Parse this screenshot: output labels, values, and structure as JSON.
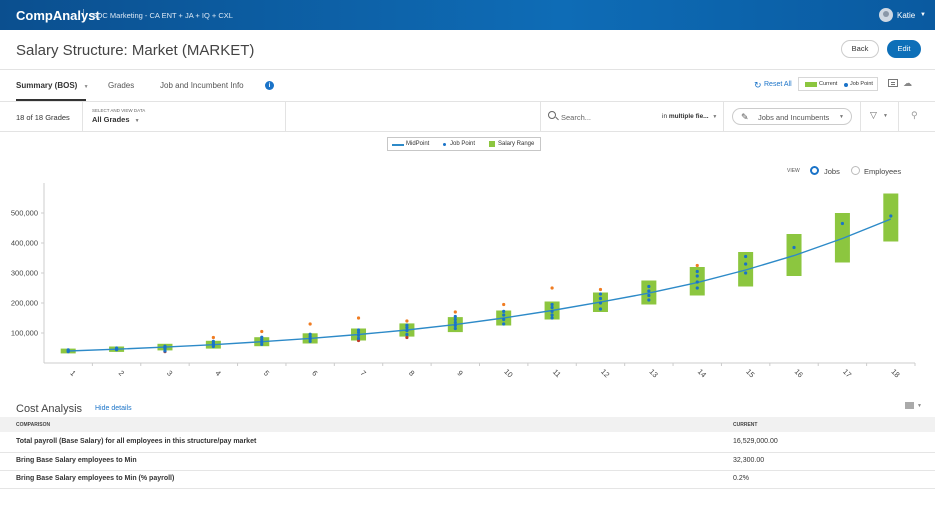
{
  "app": {
    "brand": "CompAnalyst",
    "context": "SDC Marketing - CA ENT + JA + IQ + CXL",
    "user": "Katie"
  },
  "page": {
    "title": "Salary Structure: Market (MARKET)",
    "back_label": "Back",
    "edit_label": "Edit"
  },
  "tabs": [
    {
      "label": "Summary (BOS)",
      "active": true
    },
    {
      "label": "Grades",
      "active": false
    },
    {
      "label": "Job and Incumbent Info",
      "active": false
    }
  ],
  "toolbar": {
    "reset_label": "Reset All",
    "legend_current": "Current",
    "legend_jobpoint": "Job Point"
  },
  "filterbar": {
    "count_label": "18 of 18 Grades",
    "select_caption": "SELECT AND VIEW DATA",
    "select_value": "All Grades",
    "search_placeholder": "Search...",
    "scope_prefix": "in ",
    "scope_value": "multiple fie...",
    "jobs_filter_label": "Jobs and Incumbents"
  },
  "view": {
    "label": "VIEW",
    "options": [
      {
        "label": "Jobs",
        "selected": true
      },
      {
        "label": "Employees",
        "selected": false
      }
    ]
  },
  "colors": {
    "range_green": "#8cc63f",
    "midpoint_line": "#2d8ac8",
    "job_point_blue": "#1a73c8",
    "outlier_orange": "#f07c22",
    "outlier_red": "#c0392b"
  },
  "chart_data": {
    "type": "bar",
    "legend": [
      "MidPoint",
      "Job Point",
      "Salary Range"
    ],
    "categories": [
      "1",
      "2",
      "3",
      "4",
      "5",
      "6",
      "7",
      "8",
      "9",
      "10",
      "11",
      "12",
      "13",
      "14",
      "15",
      "16",
      "17",
      "18"
    ],
    "ylim": [
      0,
      600000
    ],
    "yticks": [
      "100,000",
      "200,000",
      "300,000",
      "400,000",
      "500,000"
    ],
    "ytick_values": [
      100000,
      200000,
      300000,
      400000,
      500000
    ],
    "midpoint": [
      40000,
      46000,
      53000,
      61000,
      71000,
      82000,
      95000,
      110000,
      128000,
      150000,
      175000,
      203000,
      233000,
      268000,
      310000,
      358000,
      415000,
      480000
    ],
    "range_min": [
      32000,
      37000,
      42000,
      48000,
      56000,
      65000,
      75000,
      88000,
      103000,
      125000,
      145000,
      170000,
      195000,
      225000,
      255000,
      290000,
      335000,
      405000
    ],
    "range_max": [
      48000,
      55000,
      64000,
      74000,
      86000,
      99000,
      115000,
      132000,
      153000,
      175000,
      205000,
      235000,
      275000,
      320000,
      370000,
      430000,
      500000,
      565000
    ],
    "job_points": [
      [
        38000,
        41000,
        44000
      ],
      [
        44000,
        47000,
        50000
      ],
      [
        48000,
        52000,
        56000,
        40000
      ],
      [
        55000,
        60000,
        66000,
        72000
      ],
      [
        62000,
        70000,
        78000,
        86000
      ],
      [
        72000,
        80000,
        88000,
        96000
      ],
      [
        82000,
        92000,
        102000,
        110000
      ],
      [
        95000,
        108000,
        118000,
        126000
      ],
      [
        115000,
        125000,
        135000,
        145000,
        155000
      ],
      [
        130000,
        145000,
        160000,
        172000
      ],
      [
        160000,
        172000,
        185000,
        195000,
        150000
      ],
      [
        180000,
        200000,
        215000,
        230000
      ],
      [
        210000,
        225000,
        240000,
        255000
      ],
      [
        250000,
        270000,
        290000,
        305000
      ],
      [
        300000,
        330000,
        355000
      ],
      [
        385000
      ],
      [
        465000
      ],
      [
        490000
      ]
    ],
    "outliers_high": [
      null,
      null,
      null,
      85000,
      105000,
      130000,
      150000,
      140000,
      170000,
      195000,
      250000,
      245000,
      null,
      325000,
      null,
      null,
      null,
      null
    ],
    "outliers_low": [
      null,
      null,
      38000,
      null,
      null,
      null,
      75000,
      85000,
      null,
      null,
      null,
      null,
      null,
      null,
      null,
      null,
      null,
      null
    ]
  },
  "cost_analysis": {
    "title": "Cost Analysis",
    "hide_label": "Hide details",
    "col_comparison": "COMPARISON",
    "col_current": "CURRENT",
    "rows": [
      {
        "label": "Total payroll (Base Salary) for all employees in this structure/pay market",
        "value": "16,529,000.00"
      },
      {
        "label": "Bring Base Salary employees to Min",
        "value": "32,300.00"
      },
      {
        "label": "Bring Base Salary employees to Min (% payroll)",
        "value": "0.2%"
      }
    ]
  }
}
